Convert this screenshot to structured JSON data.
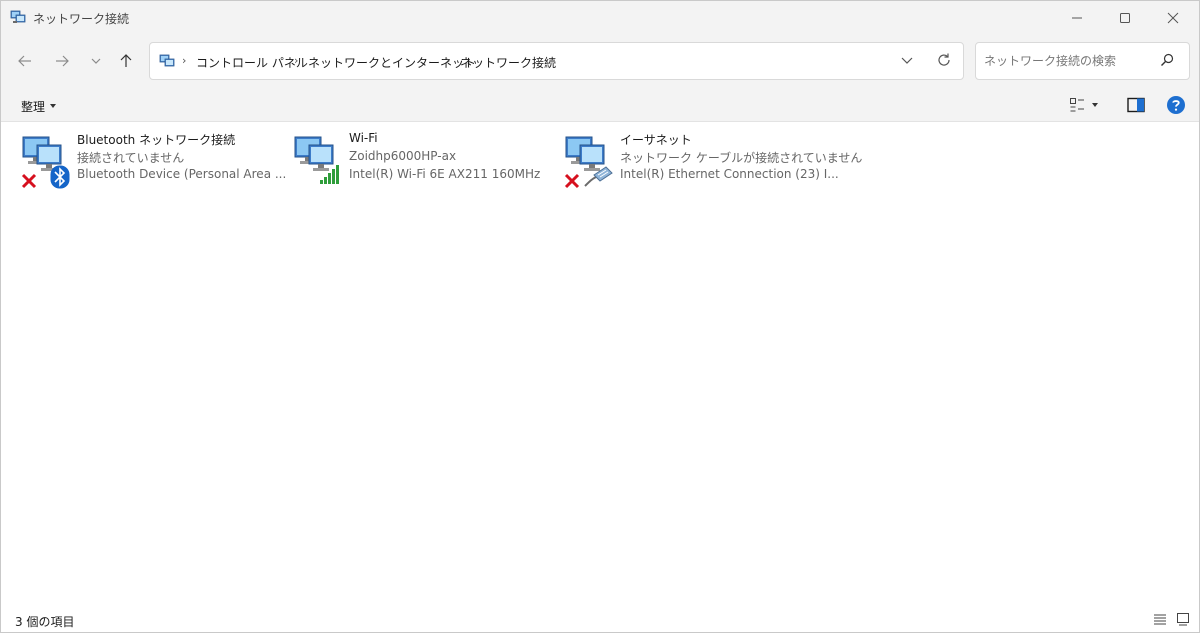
{
  "window": {
    "title": "ネットワーク接続"
  },
  "address": {
    "crumbs": [
      "コントロール パネル",
      "ネットワークとインターネット",
      "ネットワーク接続"
    ],
    "separator": "›"
  },
  "search": {
    "placeholder": "ネットワーク接続の検索"
  },
  "toolbar": {
    "organize_label": "整理"
  },
  "items": [
    {
      "name": "Bluetooth ネットワーク接続",
      "status": "接続されていません",
      "device": "Bluetooth Device (Personal Area ...",
      "badge": "bluetooth-icon",
      "disconnected": true
    },
    {
      "name": "Wi-Fi",
      "status": "Zoidhp6000HP-ax",
      "device": "Intel(R) Wi-Fi 6E AX211 160MHz",
      "badge": "signal-bars-icon",
      "disconnected": false
    },
    {
      "name": "イーサネット",
      "status": "ネットワーク ケーブルが接続されていません",
      "device": "Intel(R) Ethernet Connection (23) I...",
      "badge": "ethernet-cable-icon",
      "disconnected": true
    }
  ],
  "statusbar": {
    "count": "3 個の項目"
  },
  "colors": {
    "chrome": "#f3f3f3",
    "accent": "#0a66c2",
    "disconnect_red": "#d6101e",
    "signal_green": "#2e9d3a"
  }
}
